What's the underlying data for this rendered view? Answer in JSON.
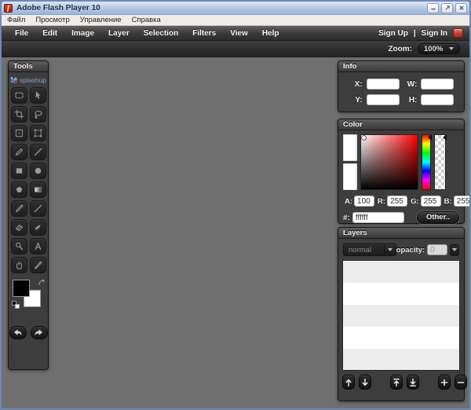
{
  "window": {
    "title": "Adobe Flash Player 10"
  },
  "player_menu": {
    "items": [
      "Файл",
      "Просмотр",
      "Управление",
      "Справка"
    ]
  },
  "app_menu": {
    "items": [
      "File",
      "Edit",
      "Image",
      "Layer",
      "Selection",
      "Filters",
      "View",
      "Help"
    ],
    "sign_up": "Sign Up",
    "divider": "|",
    "sign_in": "Sign In"
  },
  "toolbar": {
    "zoom_label": "Zoom:",
    "zoom_value": "100%"
  },
  "tools_panel": {
    "title": "Tools",
    "logo_text": "splashup",
    "tools": [
      "marquee-select",
      "move",
      "crop",
      "lasso",
      "bounding-select",
      "free-transform",
      "pencil",
      "line",
      "rectangle-shape",
      "ellipse-shape",
      "polygon-shape",
      "gradient",
      "brush",
      "pen",
      "eraser",
      "smudge",
      "dodge",
      "text",
      "hand",
      "sharpen"
    ]
  },
  "info_panel": {
    "title": "Info",
    "x_label": "X:",
    "x_value": "",
    "y_label": "Y:",
    "y_value": "",
    "w_label": "W:",
    "w_value": "",
    "h_label": "H:",
    "h_value": ""
  },
  "color_panel": {
    "title": "Color",
    "a_label": "A:",
    "a_value": "100",
    "r_label": "R:",
    "r_value": "255",
    "g_label": "G:",
    "g_value": "255",
    "b_label": "B:",
    "b_value": "255",
    "hex_label": "#:",
    "hex_value": "ffffff",
    "other_button": "Other..",
    "selected_color": "#ffffff"
  },
  "layers_panel": {
    "title": "Layers",
    "blend_mode": "normal",
    "opacity_label": "opacity:",
    "opacity_value": "0",
    "buttons": [
      "move-layer-up",
      "move-layer-down",
      "layer-to-top",
      "layer-to-bottom",
      "add-layer",
      "delete-layer"
    ]
  },
  "colors": {
    "titlebar_blue": "#a7bfe0",
    "canvas_gray": "#6f6f6f",
    "panel_dark": "#3d3d3d",
    "accent_red": "#c03a2e"
  }
}
